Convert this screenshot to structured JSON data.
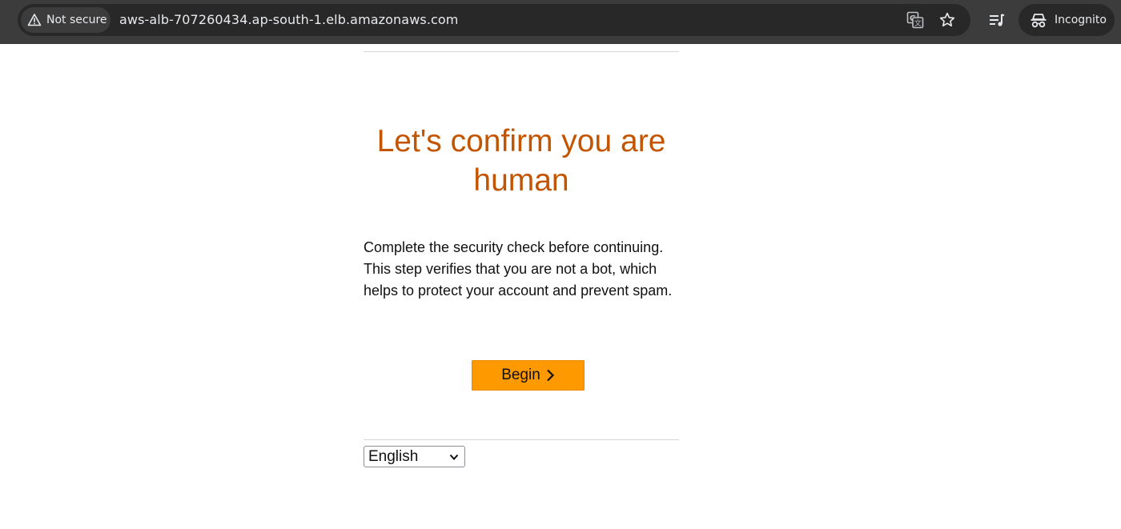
{
  "browser": {
    "security_label": "Not secure",
    "url": "aws-alb-707260434.ap-south-1.elb.amazonaws.com",
    "profile_label": "Incognito",
    "icons": [
      "warning-icon",
      "translate-icon",
      "star-icon",
      "reading-list-icon",
      "incognito-icon"
    ]
  },
  "page": {
    "title": "Let's confirm you are human",
    "description": "Complete the security check before continuing. This step verifies that you are not a bot, which helps to protect your account and prevent spam.",
    "begin_label": "Begin",
    "language": {
      "selected": "English"
    }
  },
  "colors": {
    "title": "#c45500",
    "button_bg": "#ff9900",
    "toolbar_bg": "#3c3c3c",
    "omnibox_bg": "#282828"
  }
}
